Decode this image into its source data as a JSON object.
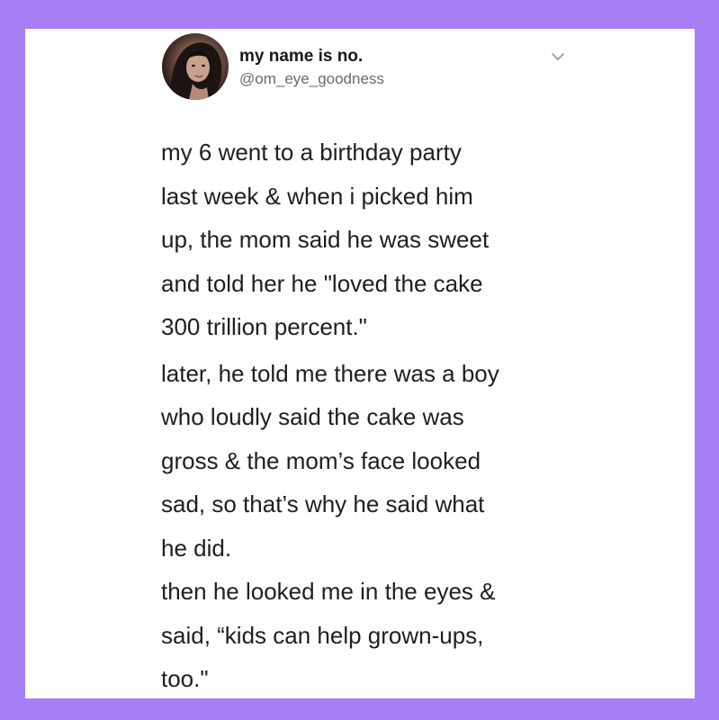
{
  "colors": {
    "border": "#a67ef5",
    "card": "#ffffff",
    "text": "#1f1f1f",
    "handle": "#6b6b6b"
  },
  "tweet": {
    "author": {
      "display_name": "my name is no.",
      "handle": "@om_eye_goodness",
      "avatar_icon": "avatar-photo"
    },
    "menu_icon": "chevron-down-icon",
    "paragraphs": [
      "my 6 went to a birthday party\nlast week & when i picked him\nup, the mom said he was sweet\nand told her he \"loved the cake\n300 trillion percent.\"",
      "later, he told me there was a boy\nwho loudly said the cake was\ngross & the mom’s face looked\nsad, so that’s why he said what\nhe did.",
      "then he looked me in the eyes &\nsaid, “kids can help grown-ups,\ntoo.\""
    ]
  }
}
